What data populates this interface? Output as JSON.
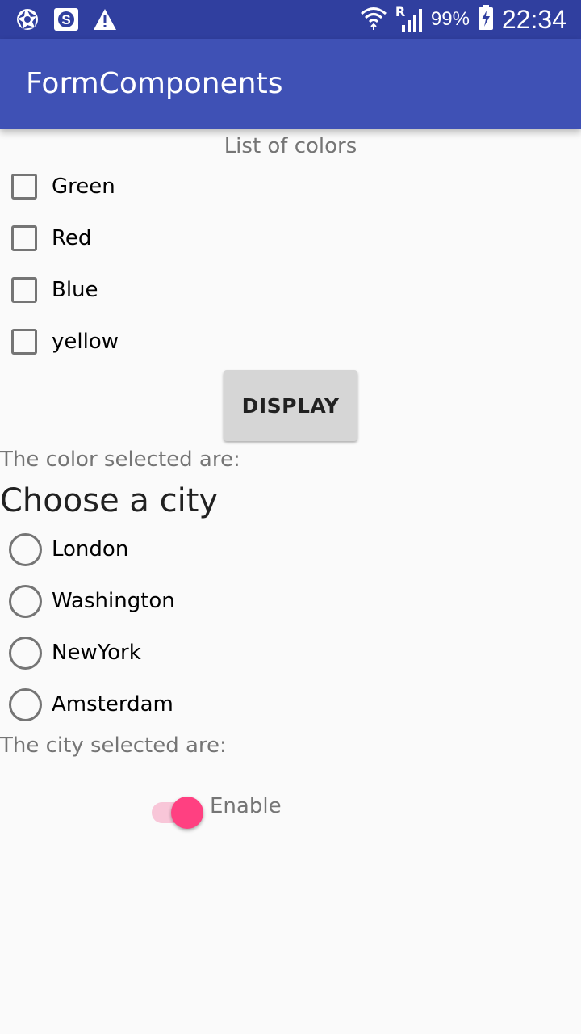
{
  "status_bar": {
    "left_icons": [
      "aperture-icon",
      "s-badge-icon",
      "warning-icon"
    ],
    "right_icons": [
      "wifi-icon",
      "signal-icon",
      "battery-charging-icon"
    ],
    "signal_roaming": "R",
    "battery": "99%",
    "time": "22:34",
    "colors": {
      "background": "#303f9f"
    }
  },
  "app_bar": {
    "title": "FormComponents",
    "colors": {
      "background": "#3f51b5",
      "text": "#ffffff"
    }
  },
  "colors_section": {
    "title": "List of colors",
    "options": [
      {
        "label": "Green",
        "checked": false
      },
      {
        "label": "Red",
        "checked": false
      },
      {
        "label": "Blue",
        "checked": false
      },
      {
        "label": "yellow",
        "checked": false
      }
    ],
    "display_button": "DISPLAY",
    "selected_text": "The color selected are:"
  },
  "city_section": {
    "title": "Choose a city",
    "options": [
      {
        "label": "London",
        "selected": false
      },
      {
        "label": "Washington",
        "selected": false
      },
      {
        "label": "NewYork",
        "selected": false
      },
      {
        "label": "Amsterdam",
        "selected": false
      }
    ],
    "selected_text": "The city selected are:"
  },
  "switch": {
    "label": "Enable",
    "on": true,
    "colors": {
      "thumb": "#ff4081",
      "track": "#f8c6d8"
    }
  }
}
